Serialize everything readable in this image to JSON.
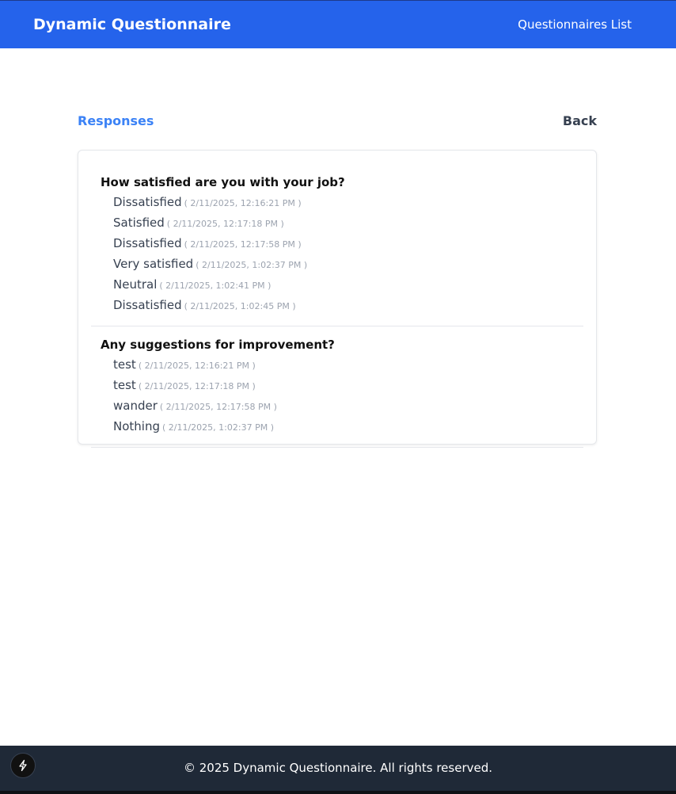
{
  "header": {
    "brand": "Dynamic Questionnaire",
    "nav_link": "Questionnaires List"
  },
  "page": {
    "section_title": "Responses",
    "back_label": "Back"
  },
  "questions": [
    {
      "text": "How satisfied are you with your job?",
      "answers": [
        {
          "value": "Dissatisfied",
          "time": "( 2/11/2025, 12:16:21 PM )"
        },
        {
          "value": "Satisfied",
          "time": "( 2/11/2025, 12:17:18 PM )"
        },
        {
          "value": "Dissatisfied",
          "time": "( 2/11/2025, 12:17:58 PM )"
        },
        {
          "value": "Very satisfied",
          "time": "( 2/11/2025, 1:02:37 PM )"
        },
        {
          "value": "Neutral",
          "time": "( 2/11/2025, 1:02:41 PM )"
        },
        {
          "value": "Dissatisfied",
          "time": "( 2/11/2025, 1:02:45 PM )"
        }
      ]
    },
    {
      "text": "Any suggestions for improvement?",
      "answers": [
        {
          "value": "test",
          "time": "( 2/11/2025, 12:16:21 PM )"
        },
        {
          "value": "test",
          "time": "( 2/11/2025, 12:17:18 PM )"
        },
        {
          "value": "wander",
          "time": "( 2/11/2025, 12:17:58 PM )"
        },
        {
          "value": "Nothing",
          "time": "( 2/11/2025, 1:02:37 PM )"
        }
      ]
    }
  ],
  "footer": {
    "text": "© 2025 Dynamic Questionnaire. All rights reserved."
  },
  "dev_tools": {
    "icon": "bolt-icon"
  },
  "colors": {
    "header_bg": "#2563eb",
    "accent": "#3b82f6",
    "footer_bg": "#1f2937"
  }
}
